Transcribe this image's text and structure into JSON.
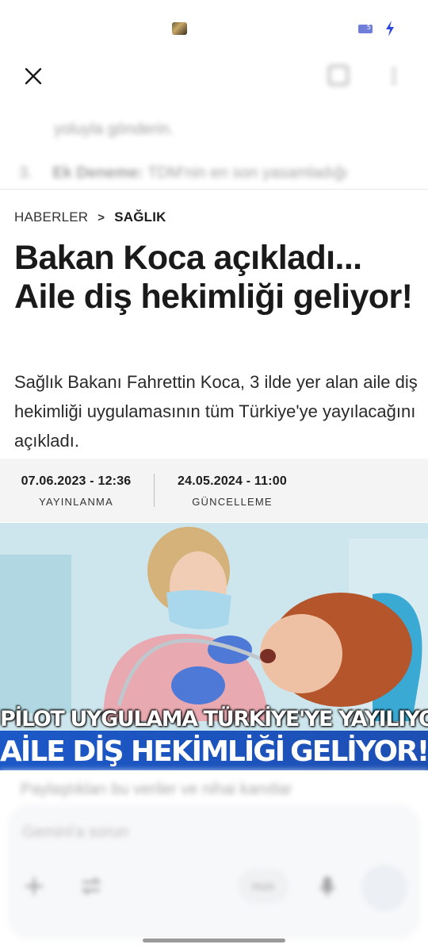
{
  "status_bar": {
    "battery_text": "5",
    "colors": {
      "battery": "#6f7fd9",
      "bolt": "#2a46e0"
    }
  },
  "top_bar": {
    "close_icon": "close-icon",
    "right_icons": [
      "edit-icon",
      "more-icon"
    ]
  },
  "background_chat": {
    "line_1": "yoluyla gönderin.",
    "line_2_number": "3.",
    "line_2_bold": "Ek Deneme:",
    "line_2_text": "TDM'nin en son yasamladığı"
  },
  "article": {
    "breadcrumb": {
      "home": "HABERLER",
      "separator": ">",
      "section": "SAĞLIK"
    },
    "headline": "Bakan Koca açıkladı... Aile diş hekimliği geliyor!",
    "summary": "Sağlık Bakanı Fahrettin Koca, 3 ilde yer alan aile diş hekimliği uygulamasının tüm Türkiye'ye yayılacağını açıkladı.",
    "published": {
      "value": "07.06.2023 - 12:36",
      "label": "YAYINLANMA"
    },
    "updated": {
      "value": "24.05.2024 - 11:00",
      "label": "GÜNCELLEME"
    },
    "hero": {
      "overlay_line_1": "PİLOT UYGULAMA TÜRKİYE'YE YAYILIYOR",
      "overlay_line_2": "AİLE DİŞ HEKİMLİĞİ",
      "overlay_line_2_accent": "GELİYOR!",
      "banner_color": "#1c58c7"
    }
  },
  "composer": {
    "prev_text": "Paylaştıkları bu veriler ve nihai kanıtlar",
    "placeholder": "Gemini'a sorun",
    "model_label": "Hızlı",
    "icons": [
      "plus-icon",
      "swap-icon",
      "mic-icon",
      "send-icon"
    ]
  }
}
